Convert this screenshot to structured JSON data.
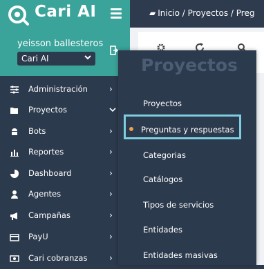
{
  "app": {
    "name": "Cari AI"
  },
  "user": {
    "name": "yeisson ballesteros",
    "company": "Cari AI"
  },
  "breadcrumb": "Inicio / Proyectos / Preg",
  "sidebar": {
    "items": [
      {
        "label": "Administración",
        "icon": "gear-icon"
      },
      {
        "label": "Proyectos",
        "icon": "folder-icon",
        "expanded": true
      },
      {
        "label": "Bots",
        "icon": "android-icon"
      },
      {
        "label": "Reportes",
        "icon": "bar-chart-icon"
      },
      {
        "label": "Dashboard",
        "icon": "pie-chart-icon"
      },
      {
        "label": "Agentes",
        "icon": "user-icon"
      },
      {
        "label": "Campañas",
        "icon": "megaphone-icon"
      },
      {
        "label": "PayU",
        "icon": "credit-card-icon"
      },
      {
        "label": "Cari cobranzas",
        "icon": "money-icon"
      }
    ]
  },
  "flyout": {
    "title": "Proyectos",
    "items": [
      {
        "label": "Proyectos"
      },
      {
        "label": "Preguntas y respuestas",
        "active": true
      },
      {
        "label": "Categorias"
      },
      {
        "label": "Catálogos"
      },
      {
        "label": "Tipos de servicios"
      },
      {
        "label": "Entidades"
      },
      {
        "label": "Entidades masivas"
      }
    ]
  },
  "colors": {
    "brand": "#3aa39a",
    "sidebar": "#2c3a4d",
    "highlight": "#7ecde0",
    "active_dot": "#f0a04b"
  }
}
